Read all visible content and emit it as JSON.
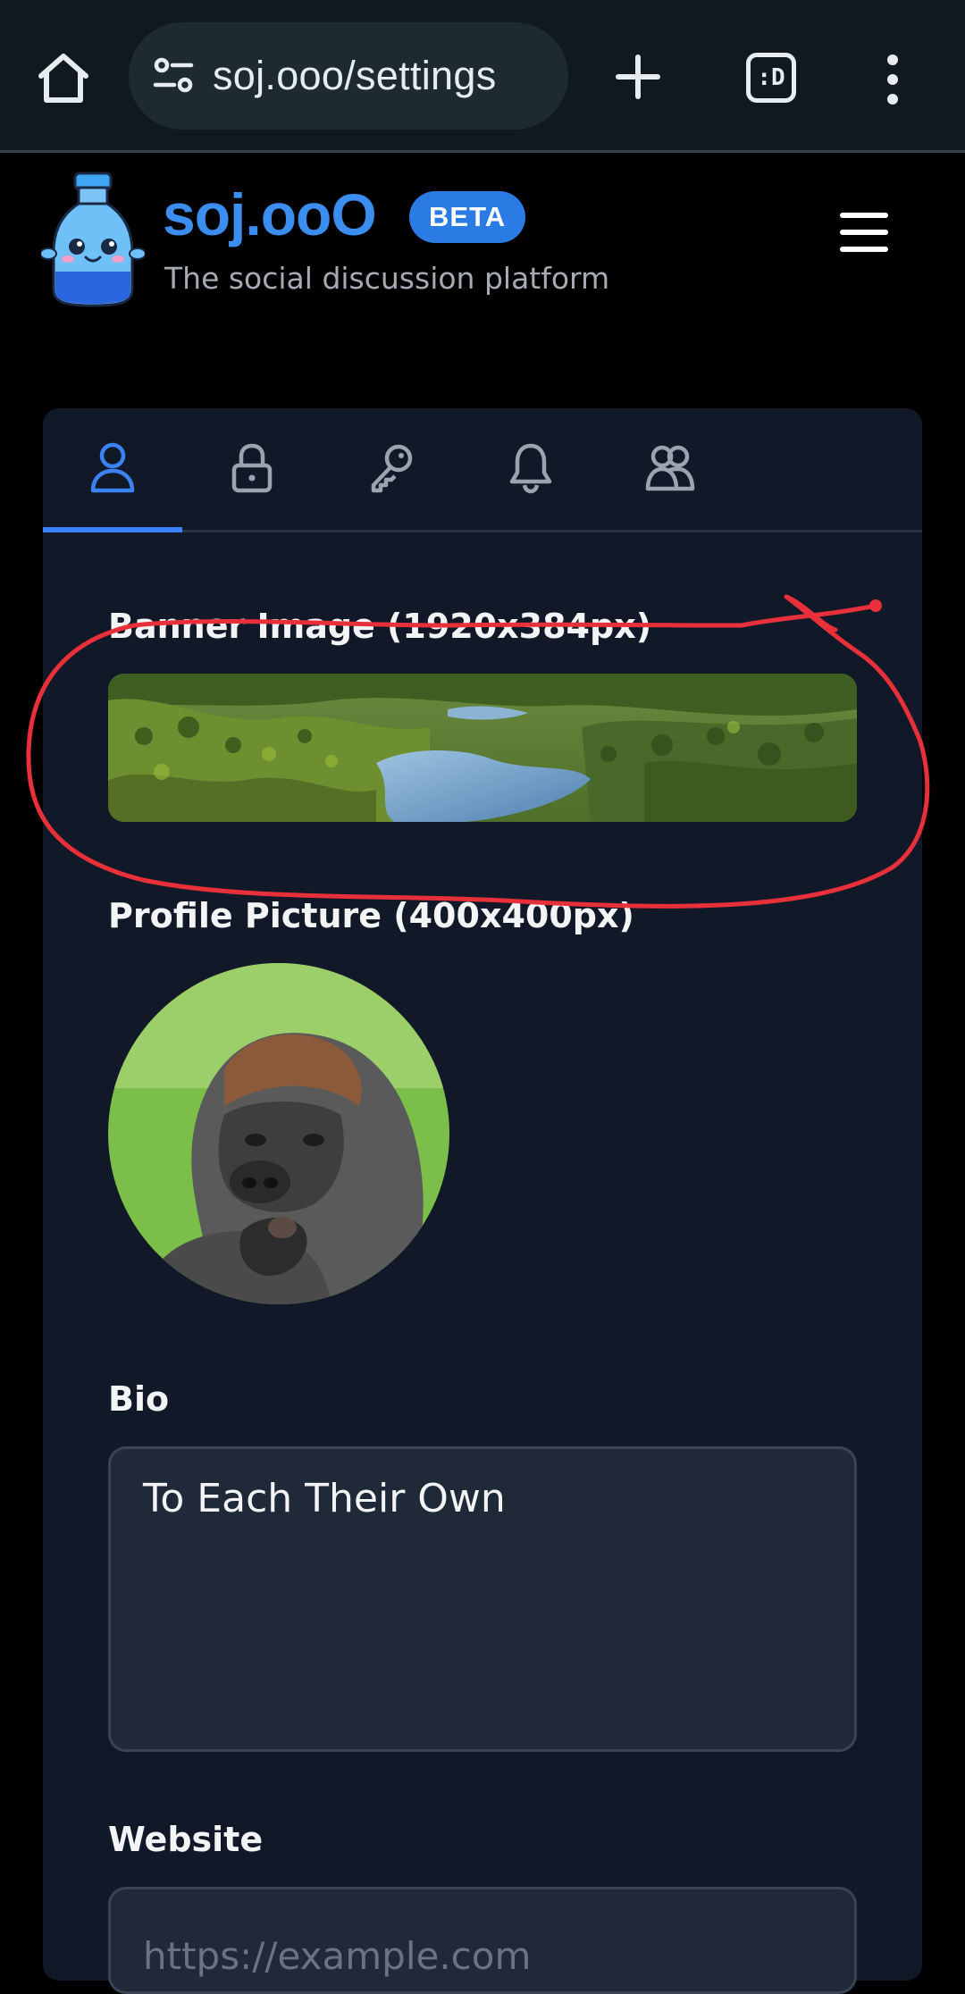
{
  "browser": {
    "url": "soj.ooo/settings",
    "tabs_count_label": ":D"
  },
  "site": {
    "brand": "soj.ooO",
    "badge": "BETA",
    "tagline": "The social discussion platform"
  },
  "settings": {
    "tabs": [
      {
        "name": "profile",
        "icon": "user-icon",
        "active": true
      },
      {
        "name": "security",
        "icon": "lock-icon",
        "active": false
      },
      {
        "name": "keys",
        "icon": "key-icon",
        "active": false
      },
      {
        "name": "notifications",
        "icon": "bell-icon",
        "active": false
      },
      {
        "name": "social",
        "icon": "users-icon",
        "active": false
      }
    ],
    "banner_label": "Banner Image (1920x384px)",
    "profile_picture_label": "Profile Picture (400x400px)",
    "bio_label": "Bio",
    "bio_value": "To Each Their Own",
    "website_label": "Website",
    "website_placeholder": "https://example.com"
  },
  "colors": {
    "accent": "#3b82f6",
    "brand": "#3b8df0",
    "card_bg": "#111827",
    "annotation": "#e8303a"
  }
}
